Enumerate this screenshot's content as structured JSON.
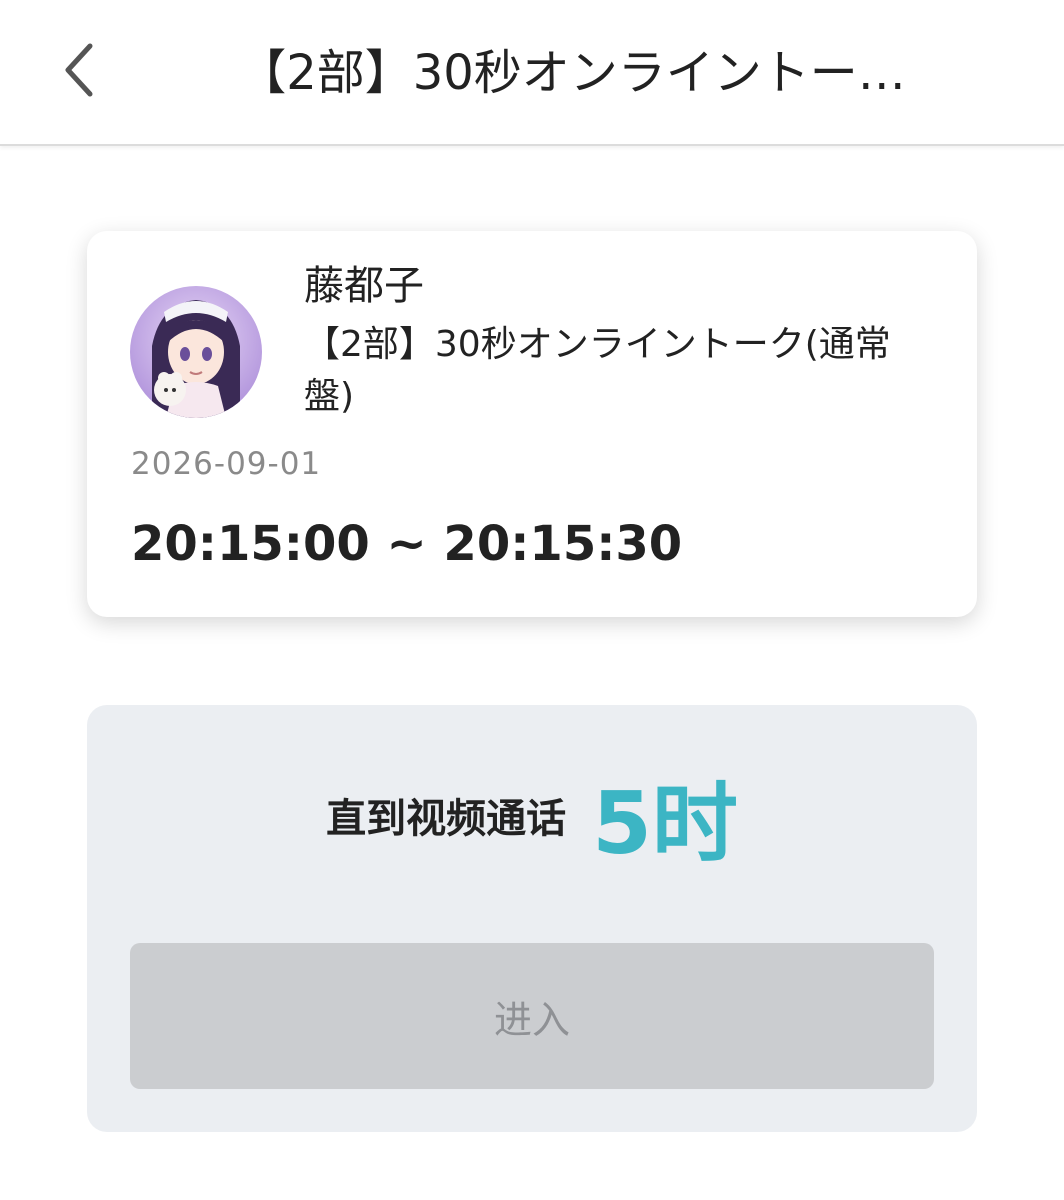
{
  "header": {
    "title": "【2部】30秒オンライントー…"
  },
  "card": {
    "streamer_name": "藤都子",
    "event_title": "【2部】30秒オンライントーク(通常盤)",
    "date": "2026-09-01",
    "time_range": "20:15:00 ~ 20:15:30"
  },
  "countdown": {
    "label": "直到视频通话",
    "value": "5时",
    "value_color": "#3cb5c4"
  },
  "enter_button": {
    "label": "进入",
    "disabled": true
  }
}
